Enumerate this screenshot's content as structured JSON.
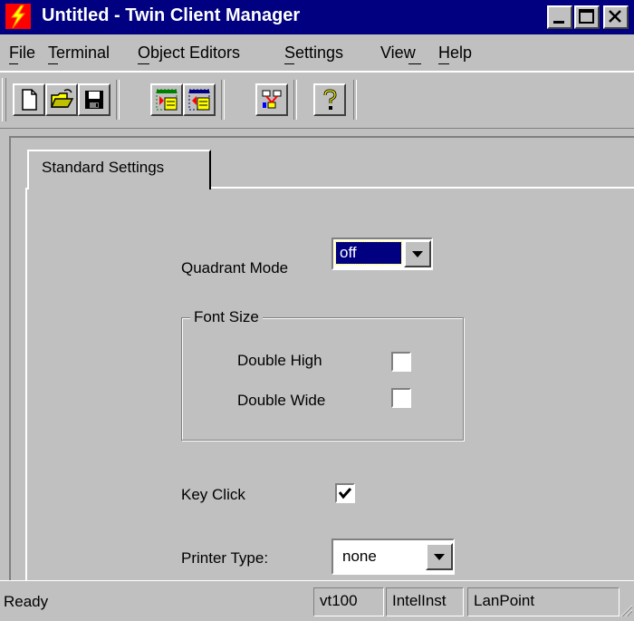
{
  "window": {
    "title": "Untitled - Twin Client Manager",
    "app_icon": "lightning-bolt-icon",
    "controls": {
      "minimize_icon": "minimize-icon",
      "maximize_icon": "maximize-icon",
      "close_icon": "close-icon"
    }
  },
  "menu": {
    "items": [
      {
        "label": "File",
        "mnemonic": "F"
      },
      {
        "label": "Terminal",
        "mnemonic": "T"
      },
      {
        "label": "Object Editors",
        "mnemonic": "O"
      },
      {
        "label": "Settings",
        "mnemonic": "S"
      },
      {
        "label": "View",
        "mnemonic": "w"
      },
      {
        "label": "Help",
        "mnemonic": "H"
      }
    ]
  },
  "toolbar": {
    "buttons": [
      {
        "icon": "new-document-icon"
      },
      {
        "icon": "open-folder-icon"
      },
      {
        "icon": "save-disk-icon"
      },
      {
        "icon": "download-to-terminal-icon"
      },
      {
        "icon": "upload-from-terminal-icon"
      },
      {
        "icon": "network-tree-icon"
      },
      {
        "icon": "help-question-icon"
      }
    ]
  },
  "tabs": [
    {
      "label": "Standard Settings",
      "selected": true
    }
  ],
  "settings": {
    "quadrant_mode": {
      "label": "Quadrant Mode",
      "value": "off"
    },
    "font_size": {
      "title": "Font Size",
      "double_high": {
        "label": "Double High",
        "checked": false
      },
      "double_wide": {
        "label": "Double Wide",
        "checked": false
      }
    },
    "key_click": {
      "label": "Key Click",
      "checked": true
    },
    "printer_type": {
      "label": "Printer Type:",
      "value": "none"
    }
  },
  "status": {
    "text": "Ready",
    "panels": [
      "vt100",
      "IntelInst",
      "LanPoint"
    ]
  },
  "colors": {
    "titlebar": "#000080",
    "face": "#c0c0c0",
    "selection": "#000080",
    "bolt": "#ff0000"
  }
}
